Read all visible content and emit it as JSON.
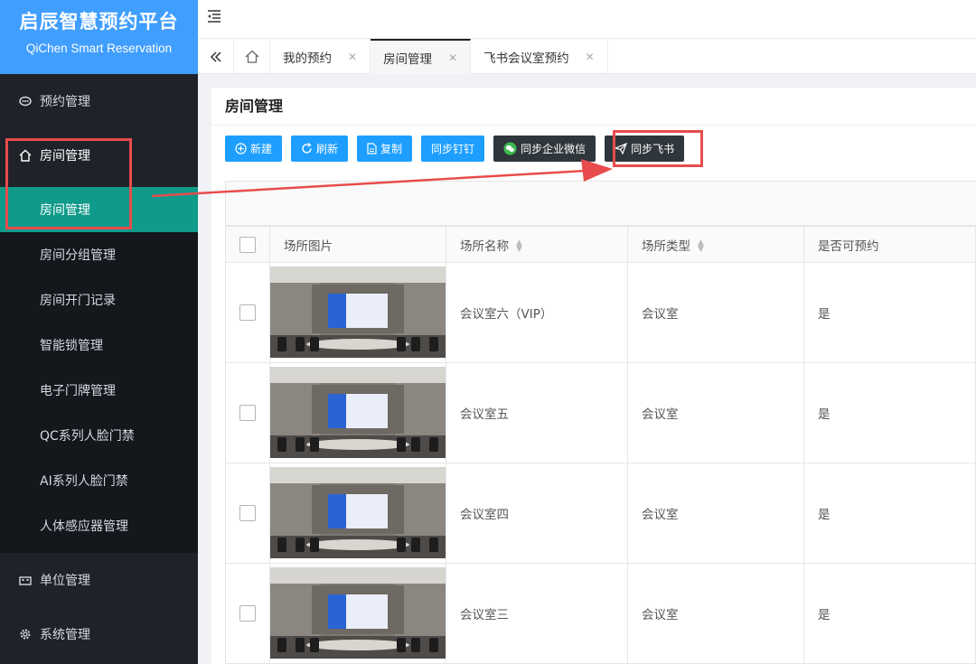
{
  "app": {
    "title": "启辰智慧预约平台",
    "subtitle": "QiChen Smart Reservation"
  },
  "sidebar": {
    "menu": [
      {
        "label": "预约管理",
        "icon": "reservation-icon"
      },
      {
        "label": "房间管理",
        "icon": "home-icon"
      },
      {
        "label": "单位管理",
        "icon": "building-icon"
      },
      {
        "label": "系统管理",
        "icon": "gear-icon"
      }
    ],
    "submenu": [
      {
        "label": "房间管理",
        "active": true
      },
      {
        "label": "房间分组管理"
      },
      {
        "label": "房间开门记录"
      },
      {
        "label": "智能锁管理"
      },
      {
        "label": "电子门牌管理"
      },
      {
        "label": "QC系列人脸门禁"
      },
      {
        "label": "AI系列人脸门禁"
      },
      {
        "label": "人体感应器管理"
      }
    ]
  },
  "tabs": [
    {
      "label": "我的预约"
    },
    {
      "label": "房间管理",
      "active": true
    },
    {
      "label": "飞书会议室预约"
    }
  ],
  "panel": {
    "title": "房间管理",
    "toolbar": {
      "new": "新建",
      "refresh": "刷新",
      "copy": "复制",
      "sync_dingtalk": "同步钉钉",
      "sync_wecom": "同步企业微信",
      "sync_feishu": "同步飞书"
    }
  },
  "table": {
    "columns": [
      "场所图片",
      "场所名称",
      "场所类型",
      "是否可预约"
    ],
    "rows": [
      {
        "name": "会议室六（VIP）",
        "type": "会议室",
        "bookable": "是"
      },
      {
        "name": "会议室五",
        "type": "会议室",
        "bookable": "是"
      },
      {
        "name": "会议室四",
        "type": "会议室",
        "bookable": "是"
      },
      {
        "name": "会议室三",
        "type": "会议室",
        "bookable": "是"
      }
    ]
  },
  "colors": {
    "brand": "#409eff",
    "sidebar_bg": "#1f2329",
    "active_menu": "#0f9a8a",
    "primary_button": "#1e9fff",
    "dark_button": "#2f363c",
    "highlight": "#e84c4c"
  }
}
